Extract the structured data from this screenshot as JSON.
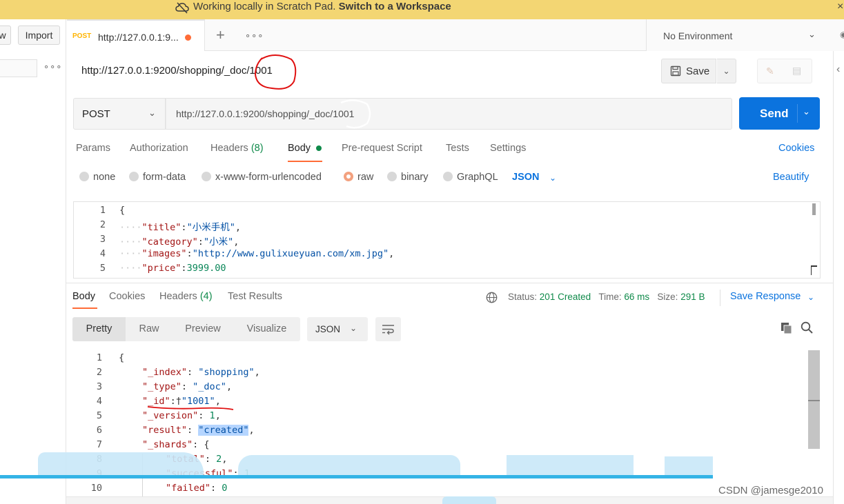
{
  "banner": {
    "text_normal": "Working locally in Scratch Pad.",
    "text_bold": "Switch to a Workspace",
    "close": "×",
    "bg_color": "#f3d673"
  },
  "sidebar": {
    "new_label": "w",
    "import_label": "Import",
    "more_label": "∘∘∘"
  },
  "tabs": {
    "active": {
      "method": "POST",
      "url": "http://127.0.0.1:9...",
      "unsaved": true
    },
    "add_label": "+",
    "more_label": "∘∘∘"
  },
  "environment": {
    "selected": "No Environment"
  },
  "request": {
    "title": "http://127.0.0.1:9200/shopping/_doc/1001",
    "method": "POST",
    "url": "http://127.0.0.1:9200/shopping/_doc/1001",
    "save_label": "Save",
    "send_label": "Send",
    "tabs": [
      {
        "label": "Params"
      },
      {
        "label": "Authorization"
      },
      {
        "label": "Headers",
        "count": "(8)"
      },
      {
        "label": "Body"
      },
      {
        "label": "Pre-request Script"
      },
      {
        "label": "Tests"
      },
      {
        "label": "Settings"
      }
    ],
    "cookies_label": "Cookies",
    "body_types": [
      "none",
      "form-data",
      "x-www-form-urlencoded",
      "raw",
      "binary",
      "GraphQL"
    ],
    "body_type_selected": "raw",
    "format": "JSON",
    "beautify_label": "Beautify",
    "body_lines": [
      {
        "n": "1",
        "text": "{"
      },
      {
        "n": "2",
        "key": "\"title\"",
        "value": "\"小米手机\"",
        "tail": ","
      },
      {
        "n": "3",
        "key": "\"category\"",
        "value": "\"小米\"",
        "tail": ","
      },
      {
        "n": "4",
        "key": "\"images\"",
        "value": "\"http://www.gulixueyuan.com/xm.jpg\"",
        "tail": ","
      },
      {
        "n": "5",
        "key": "\"price\"",
        "value": "3999.00",
        "tail": ""
      }
    ]
  },
  "response": {
    "tabs": [
      {
        "label": "Body"
      },
      {
        "label": "Cookies"
      },
      {
        "label": "Headers",
        "count": "(4)"
      },
      {
        "label": "Test Results"
      }
    ],
    "status_label": "Status:",
    "status_value": "201 Created",
    "time_label": "Time:",
    "time_value": "66 ms",
    "size_label": "Size:",
    "size_value": "291 B",
    "save_response_label": "Save Response",
    "view_modes": [
      "Pretty",
      "Raw",
      "Preview",
      "Visualize"
    ],
    "view_selected": "Pretty",
    "format": "JSON",
    "body_lines": [
      {
        "n": "1",
        "text": "{"
      },
      {
        "n": "2",
        "key": "\"_index\"",
        "value": "\"shopping\"",
        "tail": ","
      },
      {
        "n": "3",
        "key": "\"_type\"",
        "value": "\"_doc\"",
        "tail": ","
      },
      {
        "n": "4",
        "key": "\"_id\"",
        "value": "\"1001\"",
        "tail": ","
      },
      {
        "n": "5",
        "key": "\"_version\"",
        "value": "1",
        "tail": ","
      },
      {
        "n": "6",
        "key": "\"result\"",
        "value": "\"created\"",
        "tail": ","
      },
      {
        "n": "7",
        "key": "\"_shards\"",
        "value": "{",
        "tail": ""
      },
      {
        "n": "8",
        "key": "\"total\"",
        "value": "2",
        "tail": ","
      },
      {
        "n": "9",
        "key": "\"successful\"",
        "value": "1",
        "tail": ","
      },
      {
        "n": "10",
        "key": "\"failed\"",
        "value": "0",
        "tail": ""
      }
    ]
  },
  "watermark": "CSDN @jamesge2010",
  "colors": {
    "accent_orange": "#ff6c37",
    "link_blue": "#0b73de",
    "status_green": "#0f8a4a",
    "annotation_red": "#e01010"
  }
}
